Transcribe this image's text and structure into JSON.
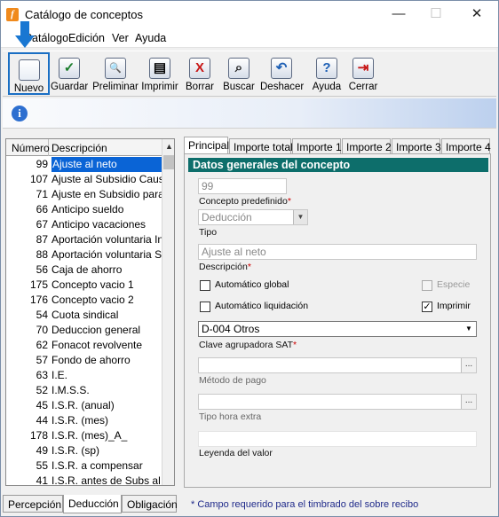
{
  "window": {
    "title": "Catálogo de conceptos",
    "minimize": "—",
    "maximize": "☐",
    "close": "✕"
  },
  "menu": [
    "Catálogo",
    "Edición",
    "Ver",
    "Ayuda"
  ],
  "toolbar": [
    {
      "label": "Nuevo",
      "icon": "new-icon",
      "glyph": ""
    },
    {
      "label": "Guardar",
      "icon": "save-icon",
      "glyph": "✓"
    },
    {
      "label": "Preliminar",
      "icon": "preview-icon",
      "glyph": "🔍"
    },
    {
      "label": "Imprimir",
      "icon": "print-icon",
      "glyph": "▤"
    },
    {
      "label": "Borrar",
      "icon": "delete-icon",
      "glyph": "X"
    },
    {
      "label": "Buscar",
      "icon": "search-icon",
      "glyph": "⌕"
    },
    {
      "label": "Deshacer",
      "icon": "undo-icon",
      "glyph": "↶"
    },
    {
      "label": "Ayuda",
      "icon": "help-icon",
      "glyph": "?"
    },
    {
      "label": "Cerrar",
      "icon": "exit-icon",
      "glyph": "⇥"
    }
  ],
  "info_icon": "i",
  "list": {
    "headers": [
      "Número",
      "Descripción"
    ],
    "rows": [
      {
        "num": "99",
        "desc": "Ajuste al neto"
      },
      {
        "num": "107",
        "desc": "Ajuste al Subsidio Causad"
      },
      {
        "num": "71",
        "desc": "Ajuste en Subsidio para el"
      },
      {
        "num": "66",
        "desc": "Anticipo sueldo"
      },
      {
        "num": "67",
        "desc": "Anticipo vacaciones"
      },
      {
        "num": "87",
        "desc": "Aportación voluntaria Info"
      },
      {
        "num": "88",
        "desc": "Aportación voluntaria SAR"
      },
      {
        "num": "56",
        "desc": "Caja de ahorro"
      },
      {
        "num": "175",
        "desc": "Concepto vacio 1"
      },
      {
        "num": "176",
        "desc": "Concepto vacio 2"
      },
      {
        "num": "54",
        "desc": "Cuota sindical"
      },
      {
        "num": "70",
        "desc": "Deduccion general"
      },
      {
        "num": "62",
        "desc": "Fonacot revolvente"
      },
      {
        "num": "57",
        "desc": "Fondo de ahorro"
      },
      {
        "num": "63",
        "desc": "I.E."
      },
      {
        "num": "52",
        "desc": "I.M.S.S."
      },
      {
        "num": "45",
        "desc": "I.S.R. (anual)"
      },
      {
        "num": "44",
        "desc": "I.S.R. (mes)"
      },
      {
        "num": "178",
        "desc": "I.S.R. (mes)_A_"
      },
      {
        "num": "49",
        "desc": "I.S.R. (sp)"
      },
      {
        "num": "55",
        "desc": "I.S.R. a compensar"
      },
      {
        "num": "41",
        "desc": "I.S.R. antes de Subs al Em"
      }
    ]
  },
  "bottom_tabs": [
    "Percepción",
    "Deducción",
    "Obligación"
  ],
  "right_tabs": [
    "Principal",
    "Importe total",
    "Importe 1",
    "Importe 2",
    "Importe 3",
    "Importe 4"
  ],
  "form": {
    "section_title": "Datos generales del concepto",
    "number_value": "99",
    "predefined_label": "Concepto predefinido",
    "req": "*",
    "type_value": "Deducción",
    "type_label": "Tipo",
    "description_value": "Ajuste al neto",
    "description_label": "Descripción",
    "auto_global": "Automático global",
    "auto_liquidacion": "Automático liquidación",
    "especie": "Especie",
    "imprimir": "Imprimir",
    "sat_value": "D-004  Otros",
    "sat_label": "Clave agrupadora SAT",
    "payment_label": "Método de pago",
    "overtime_label": "Tipo hora extra",
    "legend_label": "Leyenda del valor",
    "ellipsis": "...",
    "dd_arrow": "▼",
    "check": "✓"
  },
  "footer_note": "* Campo requerido para el timbrado del sobre recibo"
}
